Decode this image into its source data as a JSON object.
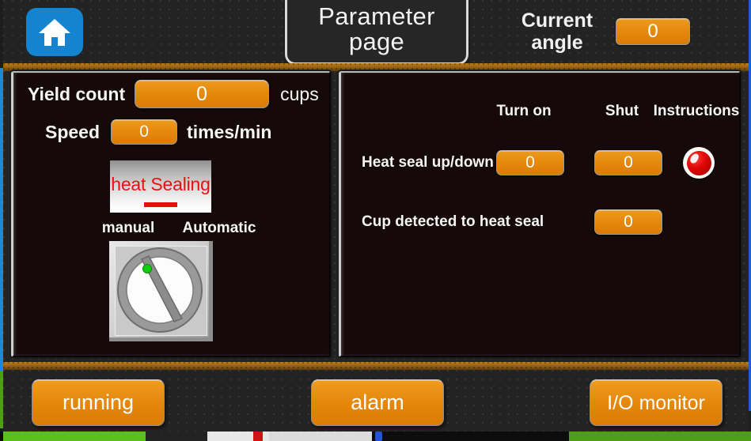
{
  "header": {
    "home_icon": "home-icon",
    "tab_title": "Parameter page",
    "angle_label": "Current angle",
    "angle_value": "0"
  },
  "left_panel": {
    "yield_label": "Yield count",
    "yield_value": "0",
    "yield_unit": "cups",
    "speed_label": "Speed",
    "speed_value": "0",
    "speed_unit": "times/min",
    "station_label": "heat Sealing",
    "mode_manual": "manual",
    "mode_automatic": "Automatic",
    "selector_icon": "rotary-selector-icon"
  },
  "right_panel": {
    "columns": [
      "Turn on",
      "Shut",
      "Instructions"
    ],
    "rows": [
      {
        "label": "Heat seal up/down",
        "turn_on": "0",
        "shut": "0",
        "indicator": "red-led-icon"
      },
      {
        "label": "Cup detected to heat seal",
        "turn_on": "",
        "shut": "0",
        "indicator": ""
      }
    ]
  },
  "footer": {
    "buttons": [
      {
        "label": "running"
      },
      {
        "label": "alarm"
      },
      {
        "label": "I/O monitor"
      }
    ]
  },
  "colors": {
    "accent_orange": "#E4860A",
    "panel_bg": "#150909",
    "header_bg": "#232323",
    "band_brown": "#95600F",
    "led_red": "#E00707",
    "heat_text_red": "#F20D0D",
    "home_blue": "#1484D1"
  }
}
